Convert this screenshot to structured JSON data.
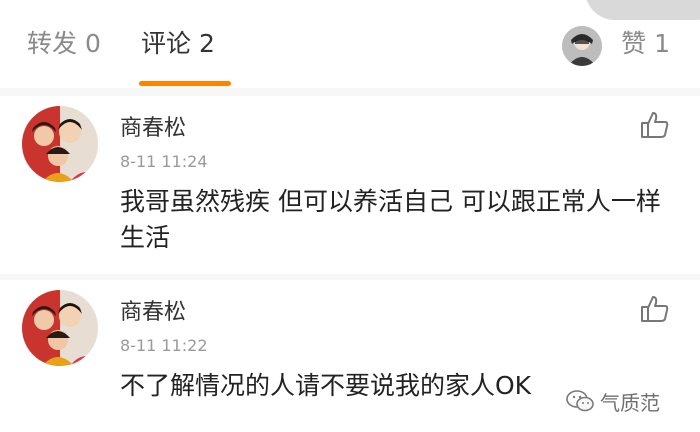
{
  "tabs": {
    "repost_label": "转发 0",
    "comment_label": "评论 2",
    "like_label": "赞 1"
  },
  "colors": {
    "accent": "#ff8200",
    "muted_text": "#8a8a8a",
    "body_text": "#222222"
  },
  "comments": [
    {
      "username": "商春松",
      "timestamp": "8-11 11:24",
      "text": "我哥虽然残疾 但可以养活自己 可以跟正常人一样生活",
      "like_icon": "thumbs-up-icon"
    },
    {
      "username": "商春松",
      "timestamp": "8-11 11:22",
      "text": "不了解情况的人请不要说我的家人OK",
      "like_icon": "thumbs-up-icon"
    }
  ],
  "watermark": {
    "text": "气质范",
    "icon": "wechat-icon"
  }
}
